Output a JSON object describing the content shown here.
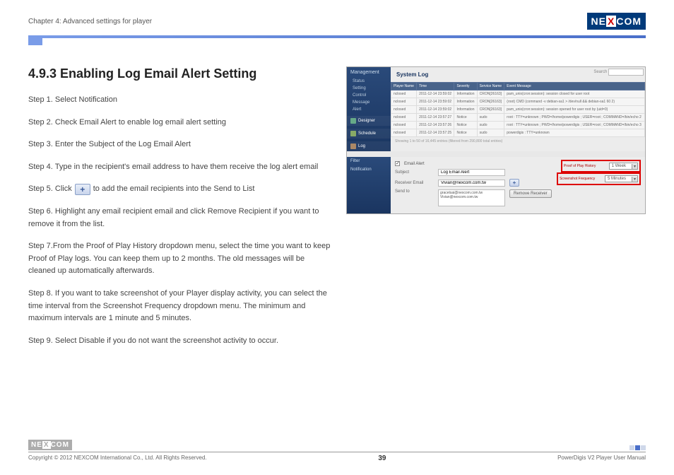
{
  "header": {
    "chapter": "Chapter 4: Advanced settings for player",
    "logo_left": "NE",
    "logo_x": "X",
    "logo_right": "COM"
  },
  "title": "4.9.3 Enabling Log Email Alert Setting",
  "steps": {
    "s1": "Step 1. Select Notification",
    "s2": "Step 2. Check Email Alert to enable log email alert setting",
    "s3": "Step 3. Enter the Subject of the Log Email Alert",
    "s4": "Step 4. Type in the recipient's email address to have them receive the log alert email",
    "s5a": "Step 5. Click",
    "s5b": "to add the email recipients into the Send to List",
    "s6": "Step 6. Highlight any email recipient email and click Remove Recipient if you want to remove it from the list.",
    "s7": "Step 7.From the Proof of Play History dropdown menu, select the time you want to keep Proof of Play logs. You can keep them up to 2 months. The old messages will be cleaned up automatically afterwards.",
    "s8": "Step 8. If you want to take screenshot of your Player display activity, you can select the time interval from the Screenshot Frequency dropdown menu. The minimum and maximum intervals are 1 minute and 5 minutes.",
    "s9": "Step 9. Select Disable if you do not want the screenshot activity to occur."
  },
  "plus_glyph": "+",
  "screenshot": {
    "mgmt": "Management",
    "menu": [
      "Status",
      "Setting",
      "Control",
      "Message",
      "Alert"
    ],
    "sections": [
      "Designer",
      "Schedule",
      "Log"
    ],
    "title": "System Log",
    "search_label": "Search",
    "table_headers": [
      "Player Name",
      "Time",
      "Severity",
      "Service Name",
      "Event Message"
    ],
    "rows": [
      [
        "nclosed",
        "2011-12-14 23:59:02",
        "Information",
        "CRON[26163]",
        "pam_unix(cron:session): session closed for user root"
      ],
      [
        "nclosed",
        "2011-12-14 23:59:02",
        "Information",
        "CRON[26163]",
        "(root) CMD (command -v debian-sa1 > /dev/null && debian-sa1 60 2)"
      ],
      [
        "nclosed",
        "2011-12-14 23:59:02",
        "Information",
        "CRON[26163]",
        "pam_unix(cron:session): session opened for user root by (uid=0)"
      ],
      [
        "nclosed",
        "2011-12-14 23:57:27",
        "Notice",
        "sudo",
        "root : TTY=unknown ; PWD=/home/powerdigis ; USER=root ; COMMAND=/bin/echo 2"
      ],
      [
        "nclosed",
        "2011-12-14 23:57:26",
        "Notice",
        "sudo",
        "root : TTY=unknown ; PWD=/home/powerdigis ; USER=root ; COMMAND=/bin/echo 3"
      ],
      [
        "nclosed",
        "2011-12-14 23:57:25",
        "Notice",
        "sudo",
        "powerdigis : TTY=unknown"
      ]
    ],
    "table_footer": "Showing 1 to 50 of 16,445 entries (filtered from 290,800 total entries)",
    "bot_menu": [
      "Filter",
      "Notification"
    ],
    "email_alert_label": "Email Alert",
    "subject_label": "Subject",
    "subject_value": "Log Email Alert",
    "receiver_label": "Receiver Email",
    "receiver_value": "Vivian@nexcom.com.tw",
    "sendto_label": "Send to",
    "sendto_list": [
      "gracetsai@nexcom.com.tw",
      "Vivian@nexcom.com.tw"
    ],
    "remove_btn": "Remove Receiver",
    "pop_history_label": "Proof of Play History",
    "pop_history_value": "1 Week",
    "shot_freq_label": "Screenshot Frequency",
    "shot_freq_value": "5 Minutes"
  },
  "footer": {
    "copyright": "Copyright © 2012 NEXCOM International Co., Ltd. All Rights Reserved.",
    "page": "39",
    "manual": "PowerDigis V2 Player User Manual"
  }
}
